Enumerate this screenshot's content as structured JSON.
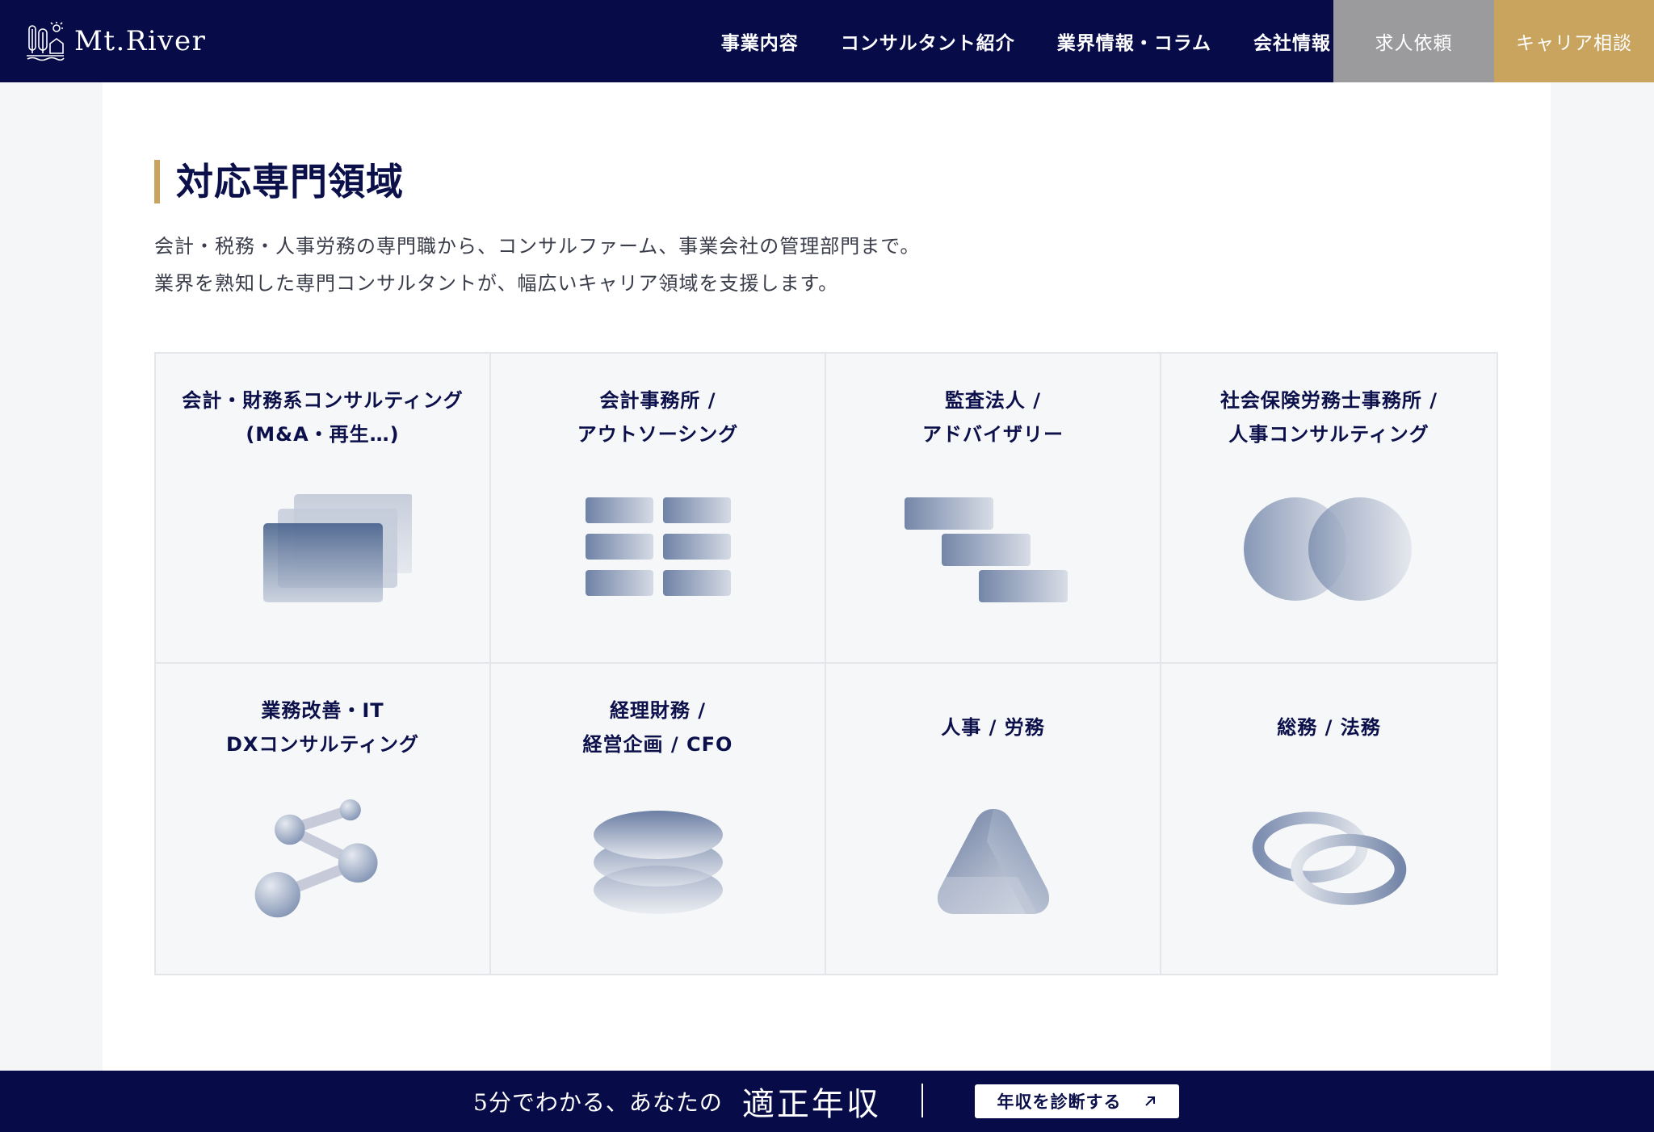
{
  "header": {
    "logo_text": "Mt.River",
    "nav": [
      "事業内容",
      "コンサルタント紹介",
      "業界情報・コラム",
      "会社情報"
    ],
    "request_button": "求人依頼",
    "career_button": "キャリア相談"
  },
  "section": {
    "title": "対応専門領域",
    "lead": [
      "会計・税務・人事労務の専門職から、コンサルファーム、事業会社の管理部門まで。",
      "業界を熟知した専門コンサルタントが、幅広いキャリア領域を支援します。"
    ]
  },
  "cards": [
    {
      "lines": [
        "会計・財務系コンサルティング",
        "(M&A・再生…)"
      ],
      "icon": "stacked-cards-icon"
    },
    {
      "lines": [
        "会計事務所 /",
        "アウトソーシング"
      ],
      "icon": "grid-blocks-icon"
    },
    {
      "lines": [
        "監査法人 /",
        "アドバイザリー"
      ],
      "icon": "staircase-bars-icon"
    },
    {
      "lines": [
        "社会保険労務士事務所 /",
        "人事コンサルティング"
      ],
      "icon": "overlapping-circles-icon"
    },
    {
      "lines": [
        "業務改善・IT",
        "DXコンサルティング"
      ],
      "icon": "network-nodes-icon"
    },
    {
      "lines": [
        "経理財務 /",
        "経営企画 / CFO"
      ],
      "icon": "stacked-discs-icon"
    },
    {
      "lines": [
        "人事 / 労務"
      ],
      "icon": "triangle-icon"
    },
    {
      "lines": [
        "総務 / 法務"
      ],
      "icon": "linked-rings-icon"
    }
  ],
  "banner": {
    "text": "5分でわかる、あなたの",
    "strong": "適正年収",
    "button": "年収を診断する",
    "button_icon": "arrow-up-right-icon"
  },
  "colors": {
    "navy": "#070b48",
    "gold": "#c9a45e",
    "gray": "#9b9b9d"
  }
}
